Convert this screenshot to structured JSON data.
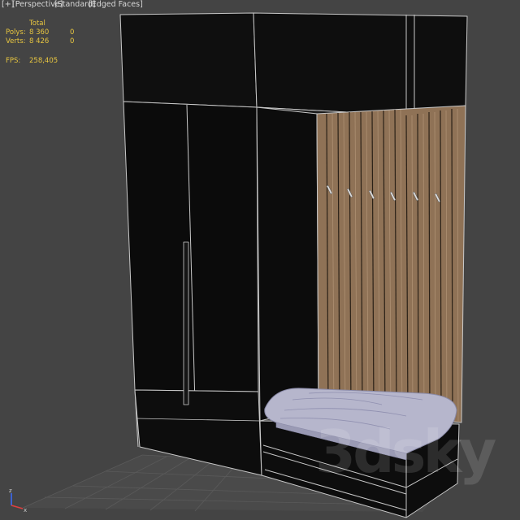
{
  "viewport_menu": {
    "plus": "[+]",
    "view": "[Perspective]",
    "shading_standard": "[Standard]",
    "shading_edged": "[Edged Faces]"
  },
  "stats": {
    "header_total": "Total",
    "polys_label": "Polys:",
    "polys_total": "8 360",
    "polys_selected": "0",
    "verts_label": "Verts:",
    "verts_total": "8 426",
    "verts_selected": "0",
    "fps_label": "FPS:",
    "fps_value": "258,405"
  },
  "axis_gizmo": {
    "x_label": "x",
    "z_label": "z"
  },
  "watermark": "3dsky",
  "colors": {
    "viewport_bg": "#444444",
    "stat_text": "#e8c640",
    "menu_text": "#d8d8d8",
    "cabinet_fill": "#0d0d0d",
    "edge_wire": "#c8c8c8",
    "wood_panel": "#8f7256",
    "cushion": "#b0b0c8"
  }
}
